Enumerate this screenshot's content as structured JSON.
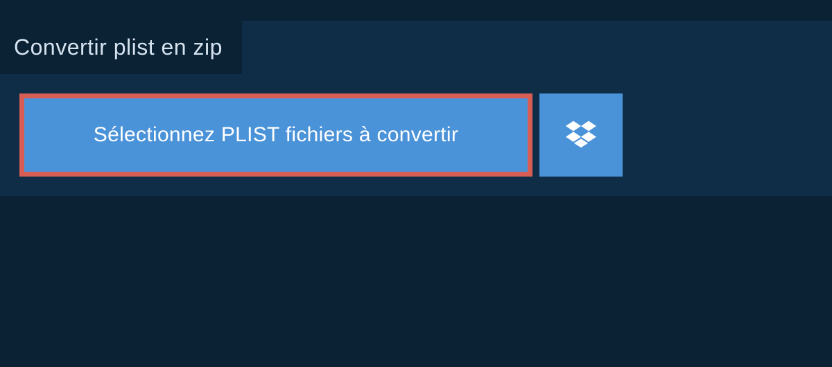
{
  "tab": {
    "label": "Convertir plist en zip"
  },
  "actions": {
    "select_label": "Sélectionnez PLIST fichiers à convertir"
  }
}
